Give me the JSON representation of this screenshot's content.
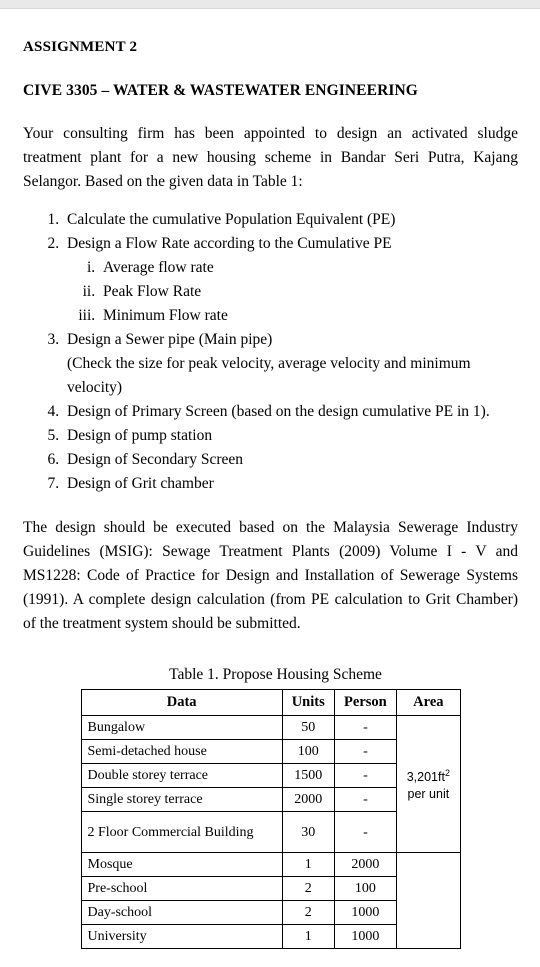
{
  "document": {
    "title": "ASSIGNMENT 2",
    "course": "CIVE 3305 – WATER & WASTEWATER ENGINEERING",
    "intro": "Your consulting firm has been appointed to design an activated sludge treatment plant for a new housing scheme in Bandar Seri Putra, Kajang Selangor. Based on the given data in Table 1:",
    "tasks": [
      "Calculate the cumulative Population Equivalent (PE)",
      "Design a Flow Rate according to the Cumulative PE",
      "Design a Sewer pipe (Main pipe)",
      "Design of Primary Screen (based on the design cumulative PE in 1).",
      "Design of pump station",
      "Design of Secondary Screen",
      "Design of Grit chamber"
    ],
    "flow_subitems": [
      "Average flow rate",
      "Peak Flow Rate",
      "Minimum Flow rate"
    ],
    "sewer_note": "(Check the size for peak velocity, average velocity and minimum velocity)",
    "closing": "The design should be executed based on the Malaysia Sewerage Industry Guidelines (MSIG): Sewage Treatment Plants (2009) Volume I - V and MS1228: Code of Practice for Design and Installation of Sewerage Systems (1991). A complete design calculation (from PE calculation to Grit Chamber) of the treatment system should be submitted.",
    "table": {
      "caption": "Table 1. Propose Housing Scheme",
      "headers": [
        "Data",
        "Units",
        "Person",
        "Area"
      ],
      "rows": [
        {
          "data": "Bungalow",
          "units": "50",
          "person": "-"
        },
        {
          "data": "Semi-detached house",
          "units": "100",
          "person": "-"
        },
        {
          "data": "Double storey terrace",
          "units": "1500",
          "person": "-"
        },
        {
          "data": "Single storey terrace",
          "units": "2000",
          "person": "-"
        },
        {
          "data": "2 Floor Commercial Building",
          "units": "30",
          "person": "-"
        },
        {
          "data": "Mosque",
          "units": "1",
          "person": "2000"
        },
        {
          "data": "Pre-school",
          "units": "2",
          "person": "100"
        },
        {
          "data": "Day-school",
          "units": "2",
          "person": "1000"
        },
        {
          "data": "University",
          "units": "1",
          "person": "1000"
        }
      ],
      "area_value_line1": "3,201ft",
      "area_value_sup": "2",
      "area_value_line2": "per unit"
    }
  }
}
